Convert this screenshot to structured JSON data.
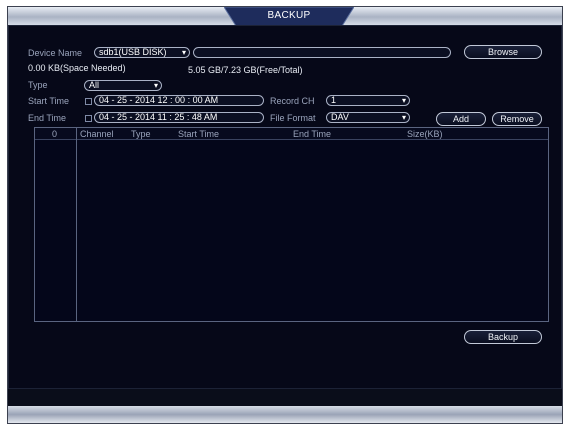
{
  "window": {
    "title": "BACKUP"
  },
  "device": {
    "label": "Device Name",
    "value": "sdb1(USB DISK)",
    "path_value": "",
    "browse_label": "Browse"
  },
  "space": {
    "needed": "0.00 KB(Space Needed)",
    "free_total": "5.05 GB/7.23 GB(Free/Total)"
  },
  "type": {
    "label": "Type",
    "value": "All"
  },
  "start": {
    "label": "Start Time",
    "value": "04 - 25 -  2014   12 : 00 : 00 AM"
  },
  "end": {
    "label": "End Time",
    "value": "04 - 25 -  2014   11 : 25 : 48 AM"
  },
  "record_ch": {
    "label": "Record CH",
    "value": "1"
  },
  "file_format": {
    "label": "File Format",
    "value": "DAV"
  },
  "buttons": {
    "add": "Add",
    "remove": "Remove",
    "backup": "Backup"
  },
  "table": {
    "index_header": "0",
    "columns": [
      "Channel",
      "Type",
      "Start Time",
      "End Time",
      "Size(KB)"
    ],
    "rows": []
  }
}
